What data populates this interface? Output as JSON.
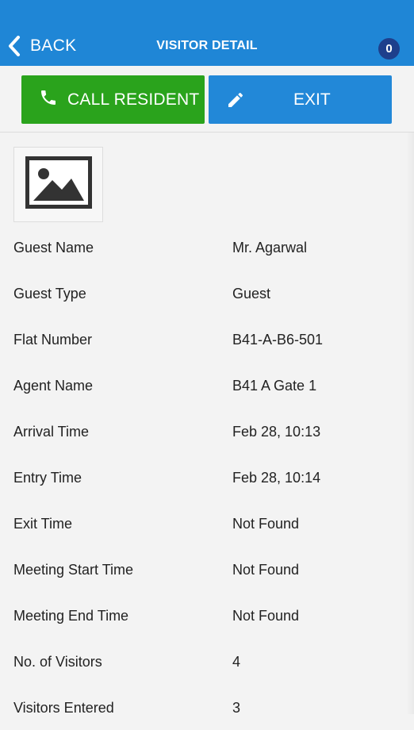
{
  "header": {
    "back_label": "BACK",
    "title": "VISITOR DETAIL",
    "count": "0",
    "background": "#1f86d6",
    "badge_color": "#1e3f8c"
  },
  "actions": {
    "call": {
      "label": "CALL RESIDENT",
      "icon": "phone-icon",
      "color": "#2aa31c"
    },
    "exit": {
      "label": "EXIT",
      "icon": "pencil-icon",
      "color": "#2288d8"
    }
  },
  "photo": {
    "icon": "image-placeholder-icon"
  },
  "details": [
    {
      "label": "Guest Name",
      "value": "Mr. Agarwal"
    },
    {
      "label": "Guest Type",
      "value": "Guest"
    },
    {
      "label": "Flat Number",
      "value": "B41-A-B6-501"
    },
    {
      "label": "Agent Name",
      "value": "B41 A Gate 1"
    },
    {
      "label": "Arrival Time",
      "value": "Feb 28, 10:13"
    },
    {
      "label": "Entry Time",
      "value": "Feb 28, 10:14"
    },
    {
      "label": "Exit Time",
      "value": "Not Found"
    },
    {
      "label": "Meeting Start Time",
      "value": "Not Found"
    },
    {
      "label": "Meeting End Time",
      "value": "Not Found"
    },
    {
      "label": "No. of Visitors",
      "value": "4"
    },
    {
      "label": "Visitors Entered",
      "value": "3"
    }
  ]
}
